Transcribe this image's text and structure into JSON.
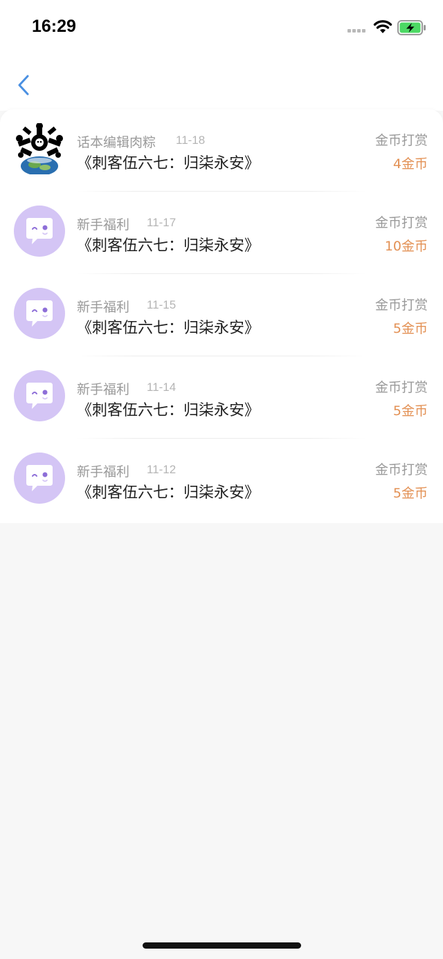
{
  "status_bar": {
    "time": "16:29",
    "icons": [
      "signal-dots-icon",
      "wifi-icon",
      "battery-charging-icon"
    ],
    "battery_color": "#4cd964"
  },
  "nav": {
    "back_icon": "chevron-left-icon",
    "accent_color": "#4a90e2"
  },
  "rewards": [
    {
      "sender": "话本编辑肉粽",
      "date": "11-18",
      "book": "《刺客伍六七：归柒永安》",
      "label": "金币打赏",
      "amount": "4金币",
      "avatar": "custom-avatar"
    },
    {
      "sender": "新手福利",
      "date": "11-17",
      "book": "《刺客伍六七：归柒永安》",
      "label": "金币打赏",
      "amount": "10金币",
      "avatar": "chat-bubble-icon"
    },
    {
      "sender": "新手福利",
      "date": "11-15",
      "book": "《刺客伍六七：归柒永安》",
      "label": "金币打赏",
      "amount": "5金币",
      "avatar": "chat-bubble-icon"
    },
    {
      "sender": "新手福利",
      "date": "11-14",
      "book": "《刺客伍六七：归柒永安》",
      "label": "金币打赏",
      "amount": "5金币",
      "avatar": "chat-bubble-icon"
    },
    {
      "sender": "新手福利",
      "date": "11-12",
      "book": "《刺客伍六七：归柒永安》",
      "label": "金币打赏",
      "amount": "5金币",
      "avatar": "chat-bubble-icon"
    }
  ],
  "colors": {
    "amount": "#e39155",
    "avatar_bg": "#d4c5f5",
    "avatar_accent": "#8e6fd8"
  }
}
